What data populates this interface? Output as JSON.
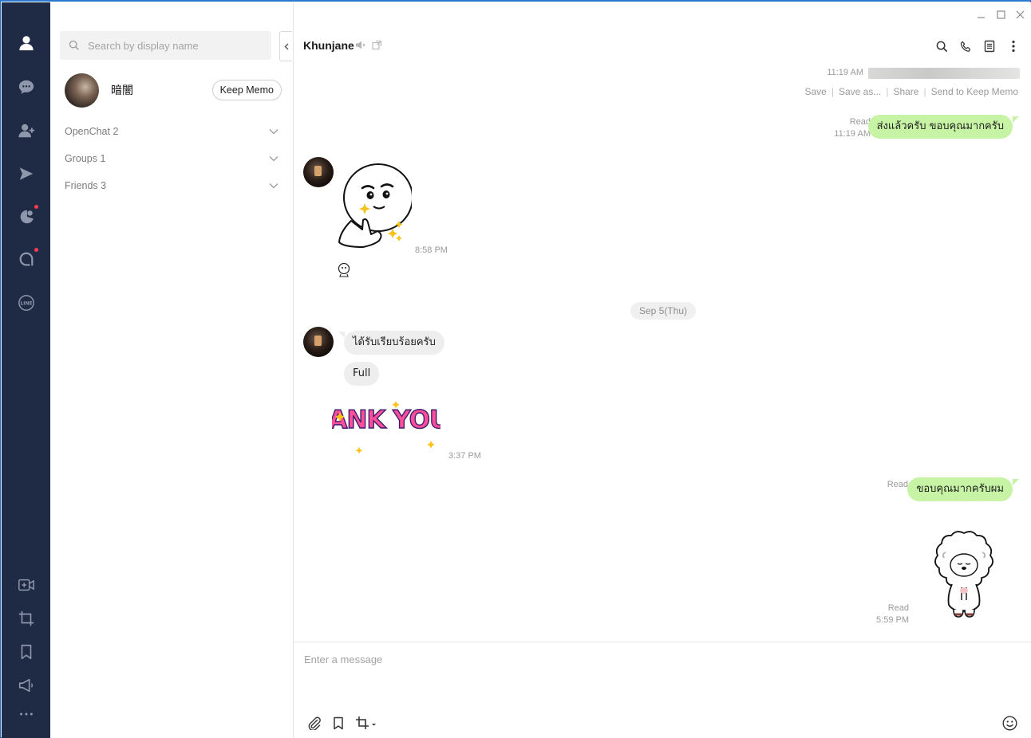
{
  "sidebar": {
    "icons": [
      "person-icon",
      "chat-icon",
      "add-friend-icon",
      "play-icon",
      "timeline-icon",
      "today-icon",
      "line-logo-icon",
      "video-call-icon",
      "crop-icon",
      "bookmark-icon",
      "announcement-icon",
      "more-icon"
    ]
  },
  "panel": {
    "search_placeholder": "Search by display name",
    "profile_name": "暗闇",
    "keep_memo_label": "Keep Memo",
    "groups": [
      {
        "label": "OpenChat 2"
      },
      {
        "label": "Groups 1"
      },
      {
        "label": "Friends 3"
      }
    ]
  },
  "chat": {
    "title": "Khunjane",
    "image_time": "11:19 AM",
    "image_actions": [
      "Save",
      "Save as...",
      "Share",
      "Send to Keep Memo"
    ],
    "messages": [
      {
        "text": "ส่งแล้วครับ ขอบคุณมากครับ",
        "read": "Read",
        "time": "11:19 AM"
      },
      {
        "time": "8:58 PM"
      },
      {
        "date": "Sep 5(Thu)"
      },
      {
        "text": "ได้รับเรียบร้อยครับ"
      },
      {
        "text": "Full"
      },
      {
        "time": "3:37 PM",
        "sticker_text": "THANK YOU!!!"
      },
      {
        "text": "ขอบคุณมากครับผม",
        "read": "Read"
      },
      {
        "read": "Read",
        "time": "5:59 PM"
      }
    ],
    "composer_placeholder": "Enter a message"
  },
  "colors": {
    "rail": "#1f2a44",
    "bubble_me": "#c6f3a4",
    "bubble_them": "#eeeeef",
    "badge": "#ff3b4f"
  }
}
